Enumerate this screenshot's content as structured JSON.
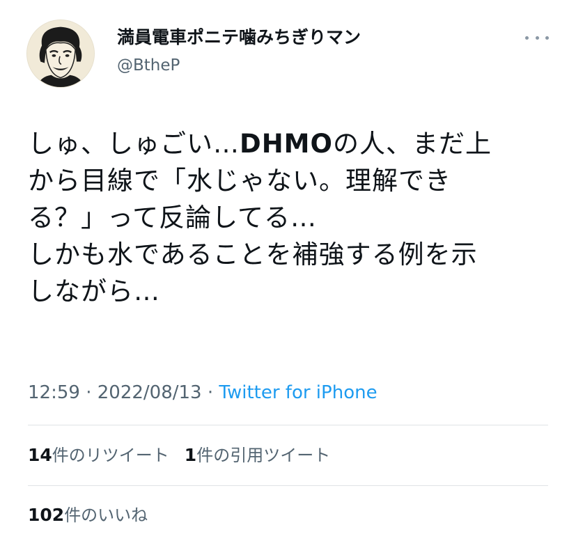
{
  "tweet": {
    "author": {
      "display_name": "満員電車ポニテ噛みちぎりマン",
      "handle": "@BtheP",
      "avatar_icon": "caricature-portrait-avatar"
    },
    "more_icon": "more-horizontal-icon",
    "text_lines": [
      {
        "before": "しゅ、しゅごい…",
        "bold": "DHMO",
        "after": "の人、まだ上"
      },
      "から目線で「水じゃない。理解でき",
      "る？」って反論してる…",
      "しかも水であることを補強する例を示",
      "しながら…"
    ],
    "time": "12:59",
    "date": "2022/08/13",
    "separator": "·",
    "source": "Twitter for iPhone"
  },
  "stats": {
    "retweets": {
      "count": "14",
      "label": "件のリツイート"
    },
    "quotes": {
      "count": "1",
      "label": "件の引用ツイート"
    },
    "likes": {
      "count": "102",
      "label": "件のいいね"
    }
  },
  "colors": {
    "text": "#0f1419",
    "muted": "#536471",
    "link": "#1d9bf0",
    "divider": "#dfe3e6",
    "avatar_bg": "#f1ead8"
  }
}
